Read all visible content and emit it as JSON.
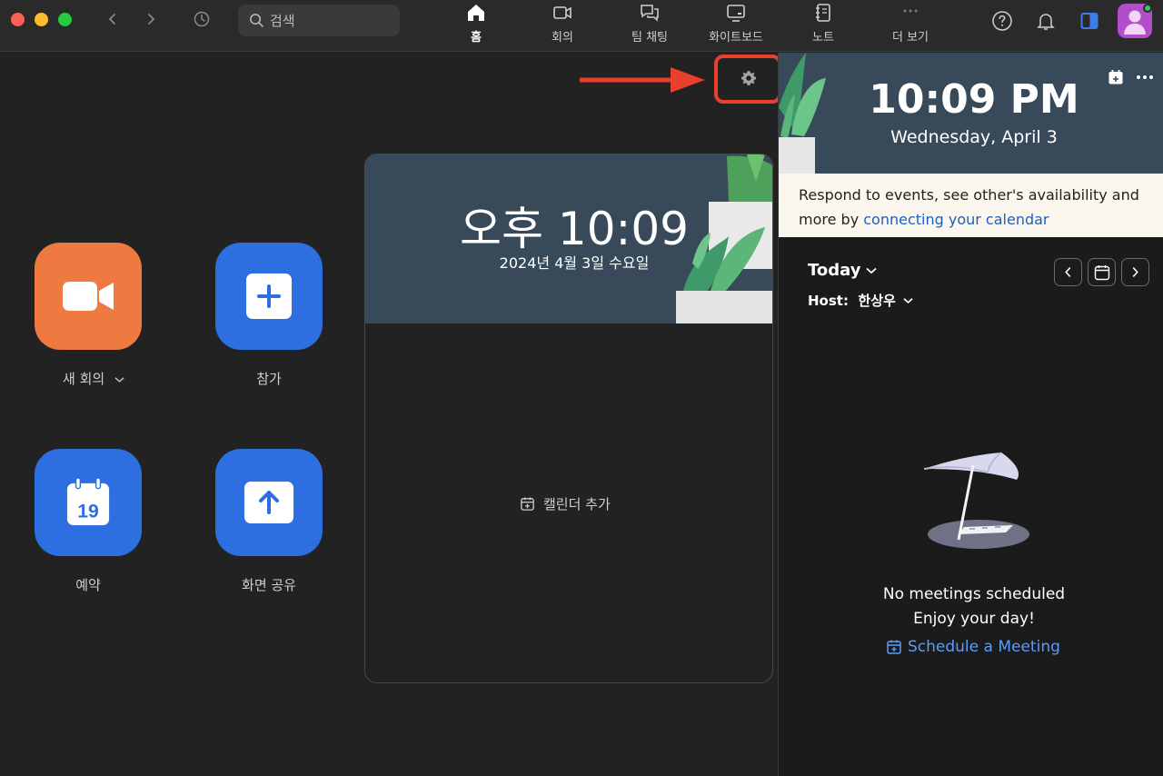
{
  "search": {
    "placeholder": "검색"
  },
  "nav": {
    "tabs": [
      {
        "label": "홈",
        "icon": "home-icon",
        "active": true
      },
      {
        "label": "회의",
        "icon": "video-icon",
        "active": false
      },
      {
        "label": "팀 채팅",
        "icon": "chat-icon",
        "active": false
      },
      {
        "label": "화이트보드",
        "icon": "whiteboard-icon",
        "active": false
      },
      {
        "label": "노트",
        "icon": "notes-icon",
        "active": false
      },
      {
        "label": "더 보기",
        "icon": "more-icon",
        "active": false
      }
    ]
  },
  "actions": {
    "new_meeting": "새 회의",
    "join": "참가",
    "schedule": "예약",
    "schedule_icon_day": "19",
    "share_screen": "화면 공유"
  },
  "clock_card": {
    "time": "오후 10:09",
    "date": "2024년 4월 3일 수요일",
    "add_calendar": "캘린더 추가"
  },
  "right_panel": {
    "time": "10:09 PM",
    "date": "Wednesday, April 3",
    "notice_text": "Respond to events, see other's availability and more by ",
    "notice_link": "connecting your calendar",
    "today_label": "Today",
    "host_label": "Host:  한상우",
    "empty_title": "No meetings scheduled",
    "empty_subtitle": "Enjoy your day!",
    "schedule_link": "Schedule a Meeting"
  },
  "colors": {
    "accent_blue": "#2d6fe1",
    "new_meeting_orange": "#ee7a41",
    "highlight_red": "#e8402c",
    "link_blue": "#5b9cf5"
  }
}
